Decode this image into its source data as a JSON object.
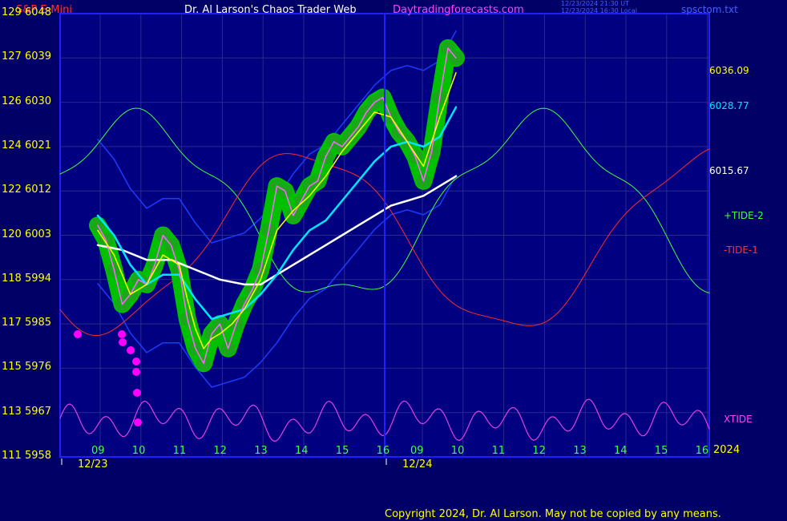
{
  "header": {
    "instrument": "S&P E-Mini",
    "title": "Dr. Al Larson's Chaos Trader Web",
    "site": "Daytradingforecasts.com",
    "stamp_line1": "12/23/2024 21:30 UT",
    "stamp_line2": "12/23/2024 16:30 Local",
    "file": "spsctom.txt"
  },
  "footer": {
    "copyright": "Copyright 2024, Dr. Al Larson. May not be copied by any means."
  },
  "colors": {
    "background": "#000066",
    "plot_bg": "#000080",
    "frame": "#2020ff",
    "price_band": "#00c000",
    "price": "#ff66ff",
    "fast_ma": "#ffff00",
    "mid_ma": "#00e5ff",
    "slow_ma": "#ffffff",
    "channel": "#1a3cff",
    "tide2": "#40ff40",
    "tide1": "#ff2a2a",
    "xtide": "#e040e0",
    "marker": "#ff00ff"
  },
  "chart_data": {
    "type": "line",
    "title": "S&P E-Mini",
    "y_left_labels": [
      {
        "a": "129",
        "b": "6048"
      },
      {
        "a": "127",
        "b": "6039"
      },
      {
        "a": "126",
        "b": "6030"
      },
      {
        "a": "124",
        "b": "6021"
      },
      {
        "a": "122",
        "b": "6012"
      },
      {
        "a": "120",
        "b": "6003"
      },
      {
        "a": "118",
        "b": "5994"
      },
      {
        "a": "117",
        "b": "5985"
      },
      {
        "a": "115",
        "b": "5976"
      },
      {
        "a": "113",
        "b": "5967"
      },
      {
        "a": "111",
        "b": "5958"
      }
    ],
    "ylim": [
      5958,
      6048
    ],
    "x_hours": [
      "09",
      "10",
      "11",
      "12",
      "13",
      "14",
      "15",
      "16",
      "09",
      "10",
      "11",
      "12",
      "13",
      "14",
      "15",
      "16"
    ],
    "x_dates": [
      "12/23",
      "12/24"
    ],
    "year": "2024",
    "right_labels": {
      "v1": "6036.09",
      "v2": "6028.77",
      "v3": "6015.67",
      "tide2": "+TIDE-2",
      "tide1": "-TIDE-1",
      "xtide": "XTIDE"
    },
    "series": [
      {
        "name": "price",
        "x": [
          0,
          0.2,
          0.4,
          0.6,
          0.8,
          1,
          1.2,
          1.4,
          1.6,
          1.8,
          2,
          2.2,
          2.4,
          2.6,
          2.8,
          3,
          3.2,
          3.4,
          3.6,
          3.8,
          4,
          4.2,
          4.4,
          4.6,
          4.8,
          5,
          5.2,
          5.4,
          5.6,
          5.8,
          6,
          6.2,
          6.4,
          6.6,
          6.8,
          7,
          7.2,
          7.4,
          7.6,
          7.8,
          8,
          8.2,
          8.4,
          8.6,
          8.8
        ],
        "values": [
          6005,
          6002,
          5996,
          5989,
          5991,
          5994,
          5993,
          5997,
          6003,
          6001,
          5996,
          5986,
          5980,
          5977,
          5983,
          5985,
          5980,
          5985,
          5989,
          5992,
          5996,
          6004,
          6013,
          6012,
          6007,
          6010,
          6013,
          6014,
          6019,
          6022,
          6021,
          6023,
          6025,
          6028,
          6030,
          6031,
          6027,
          6024,
          6022,
          6019,
          6014,
          6020,
          6031,
          6041,
          6039
        ]
      },
      {
        "name": "fast_ma",
        "x": [
          0,
          0.4,
          0.8,
          1.2,
          1.6,
          2,
          2.2,
          2.4,
          2.6,
          2.8,
          3,
          3.3,
          3.6,
          4,
          4.4,
          4.8,
          5.2,
          5.6,
          6,
          6.4,
          6.8,
          7.2,
          7.6,
          8,
          8.4,
          8.8
        ],
        "values": [
          6004,
          5999,
          5991,
          5993,
          5999,
          5997,
          5990,
          5984,
          5980,
          5982,
          5983,
          5985,
          5988,
          5994,
          6004,
          6008,
          6011,
          6015,
          6020,
          6024,
          6028,
          6027,
          6022,
          6017,
          6027,
          6036
        ]
      },
      {
        "name": "mid_ma",
        "x": [
          0,
          0.4,
          0.8,
          1.2,
          1.6,
          2,
          2.4,
          2.8,
          3.2,
          3.6,
          4,
          4.4,
          4.8,
          5.2,
          5.6,
          6,
          6.4,
          6.8,
          7.2,
          7.6,
          8,
          8.4,
          8.8
        ],
        "values": [
          6007,
          6003,
          5997,
          5993,
          5995,
          5995,
          5990,
          5986,
          5987,
          5988,
          5991,
          5995,
          6000,
          6004,
          6006,
          6010,
          6014,
          6018,
          6021,
          6022,
          6021,
          6023,
          6029
        ]
      },
      {
        "name": "slow_ma",
        "x": [
          0,
          0.6,
          1.2,
          1.8,
          2.4,
          3,
          3.6,
          4,
          4.4,
          4.8,
          5.2,
          5.6,
          6,
          6.4,
          6.8,
          7.2,
          7.6,
          8,
          8.4,
          8.8
        ],
        "values": [
          6001,
          6000,
          5998,
          5998,
          5996,
          5994,
          5993,
          5993,
          5995,
          5997,
          5999,
          6001,
          6003,
          6005,
          6007,
          6009,
          6010,
          6011,
          6013,
          6015
        ]
      }
    ]
  }
}
